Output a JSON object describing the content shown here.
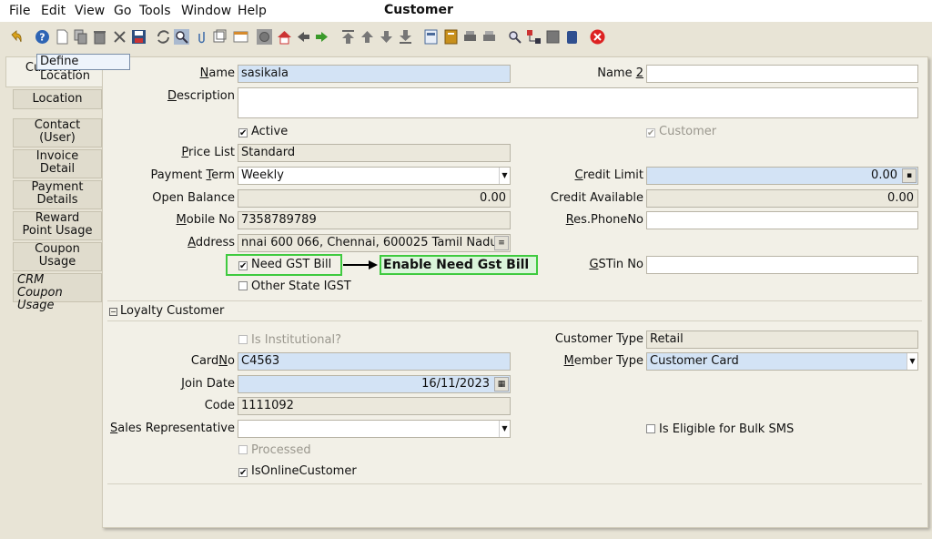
{
  "window": {
    "title": "Customer"
  },
  "menu": [
    "File",
    "Edit",
    "View",
    "Go",
    "Tools",
    "Window",
    "Help"
  ],
  "tabs": {
    "active": "Customer",
    "items": [
      "Location",
      "Contact\n(User)",
      "Invoice\nDetail",
      "Payment\nDetails",
      "Reward\nPoint Usage",
      "Coupon\nUsage",
      "CRM\nCoupon Usage"
    ]
  },
  "tooltip": "Define Location",
  "form": {
    "name": {
      "label": "Name",
      "value": "sasikala"
    },
    "name2": {
      "label": "Name 2",
      "value": ""
    },
    "description": {
      "label": "Description",
      "value": ""
    },
    "active": {
      "label": "Active",
      "checked": true
    },
    "customer": {
      "label": "Customer",
      "checked": true
    },
    "price_list": {
      "label": "Price List",
      "value": "Standard"
    },
    "payment_term": {
      "label": "Payment Term",
      "value": "Weekly"
    },
    "credit_limit": {
      "label": "Credit Limit",
      "value": "0.00"
    },
    "open_balance": {
      "label": "Open Balance",
      "value": "0.00"
    },
    "credit_available": {
      "label": "Credit Available",
      "value": "0.00"
    },
    "mobile_no": {
      "label": "Mobile No",
      "value": "7358789789"
    },
    "res_phone": {
      "label": "Res.PhoneNo",
      "value": ""
    },
    "address": {
      "label": "Address",
      "value": "nnai 600 066, Chennai,  600025 Tamil Nadu"
    },
    "need_gst_bill": {
      "label": "Need GST Bill",
      "checked": true
    },
    "gstin_no": {
      "label": "GSTin No",
      "value": ""
    },
    "other_state_igst": {
      "label": "Other State IGST",
      "checked": false
    }
  },
  "annotation": {
    "text": "Enable Need Gst Bill",
    "color": "#3fca3f"
  },
  "loyalty": {
    "section_title": "Loyalty Customer",
    "is_institutional": {
      "label": "Is Institutional?",
      "checked": false
    },
    "customer_type": {
      "label": "Customer Type",
      "value": "Retail"
    },
    "card_no": {
      "label": "CardNo",
      "value": "C4563"
    },
    "member_type": {
      "label": "Member Type",
      "value": "Customer Card"
    },
    "join_date": {
      "label": "Join Date",
      "value": "16/11/2023"
    },
    "code": {
      "label": "Code",
      "value": "1111092"
    },
    "sales_rep": {
      "label": "Sales Representative",
      "value": ""
    },
    "bulk_sms": {
      "label": "Is Eligible for Bulk SMS",
      "checked": false
    },
    "processed": {
      "label": "Processed",
      "checked": false
    },
    "online_customer": {
      "label": "IsOnlineCustomer",
      "checked": true
    }
  },
  "toolbar_icons": [
    "undo-icon",
    "help-icon",
    "new-record-icon",
    "copy-record-icon",
    "delete-icon",
    "delete-selection-icon",
    "save-icon",
    "refresh-icon",
    "find-icon",
    "attachment-icon",
    "history-icon",
    "grid-toggle-icon",
    "home-icon",
    "back-icon",
    "forward-icon",
    "first-record-icon",
    "previous-record-icon",
    "next-record-icon",
    "last-record-icon",
    "report-icon",
    "archive-icon",
    "print-preview-icon",
    "print-icon",
    "zoom-across-icon",
    "workflow-icon",
    "request-icon",
    "product-info-icon",
    "close-window-icon"
  ]
}
